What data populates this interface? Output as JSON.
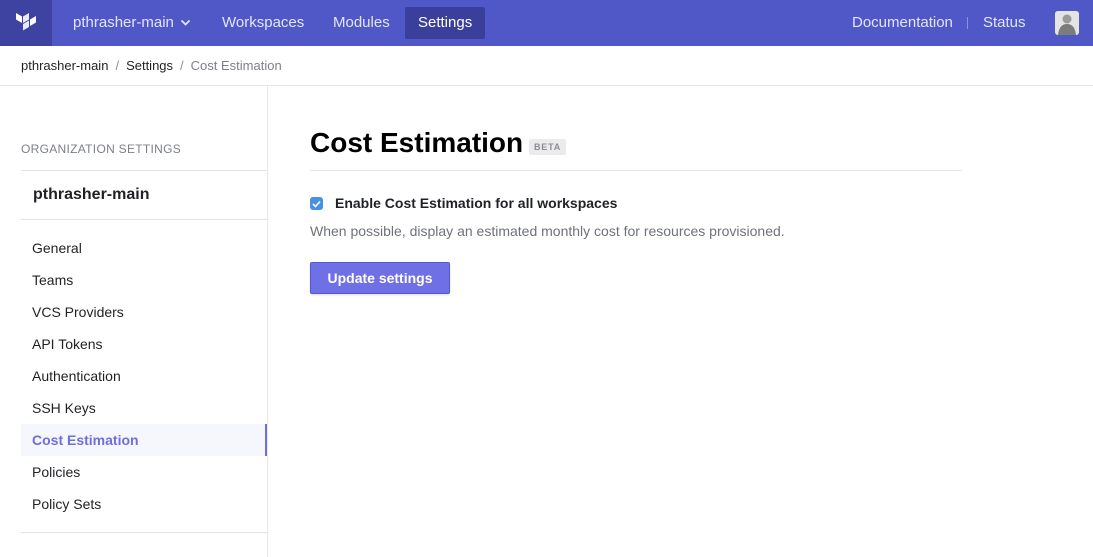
{
  "topnav": {
    "org_name": "pthrasher-main",
    "items": [
      {
        "label": "Workspaces",
        "active": false
      },
      {
        "label": "Modules",
        "active": false
      },
      {
        "label": "Settings",
        "active": true
      }
    ],
    "right": {
      "documentation": "Documentation",
      "status": "Status"
    }
  },
  "breadcrumb": {
    "items": [
      "pthrasher-main",
      "Settings",
      "Cost Estimation"
    ],
    "separator": "/"
  },
  "sidebar": {
    "heading": "ORGANIZATION SETTINGS",
    "org_name": "pthrasher-main",
    "items": [
      {
        "label": "General"
      },
      {
        "label": "Teams"
      },
      {
        "label": "VCS Providers"
      },
      {
        "label": "API Tokens"
      },
      {
        "label": "Authentication"
      },
      {
        "label": "SSH Keys"
      },
      {
        "label": "Cost Estimation",
        "active": true
      },
      {
        "label": "Policies"
      },
      {
        "label": "Policy Sets"
      }
    ]
  },
  "main": {
    "title": "Cost Estimation",
    "badge": "BETA",
    "checkbox": {
      "label": "Enable Cost Estimation for all workspaces",
      "checked": true
    },
    "help_text": "When possible, display an estimated monthly cost for resources provisioned.",
    "submit_label": "Update settings"
  },
  "colors": {
    "nav_bg": "#5058c8",
    "accent": "#6d6fdc",
    "button": "#6f70e6",
    "checkbox": "#4a90e2"
  }
}
